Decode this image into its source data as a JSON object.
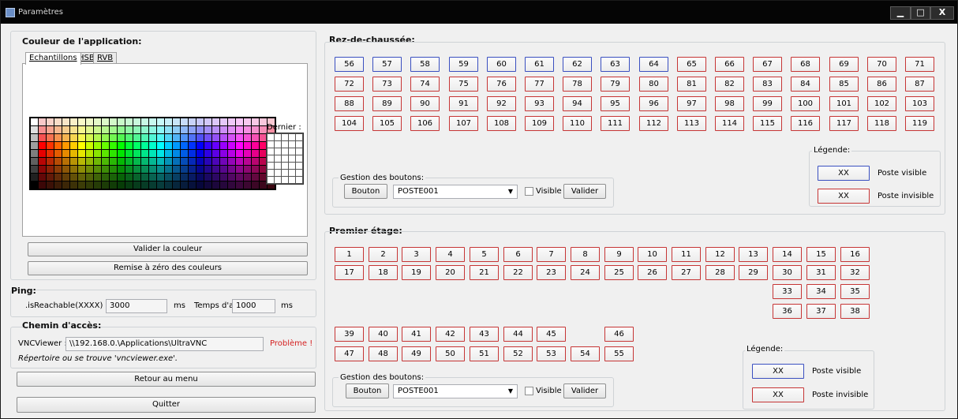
{
  "window": {
    "title": "Paramètres",
    "controls": {
      "minimize": "▁",
      "maximize": "□",
      "close": "X"
    }
  },
  "couleur": {
    "heading": "Couleur de l'application:",
    "tabs": [
      "Echantillons",
      "HSB",
      "RVB"
    ],
    "dernier_label": "Dernier :",
    "valider_label": "Valider la couleur",
    "reset_label": "Remise à zéro des couleurs"
  },
  "ping": {
    "heading": "Ping:",
    "reachable_label": ".isReachable(XXXX) :",
    "reachable_value": "3000",
    "ms1": "ms",
    "attente_label": "Temps d'attente :",
    "attente_value": "1000",
    "ms2": "ms"
  },
  "chemin": {
    "heading": "Chemin d'accès:",
    "vnc_label": "VNCViewer :",
    "vnc_value": "\\\\192.168.0.\\Applications\\UltraVNC",
    "status": "Problème !",
    "hint": "Répertoire ou se trouve 'vncviewer.exe'."
  },
  "buttons": {
    "retour": "Retour au menu",
    "quitter": "Quitter"
  },
  "rdc": {
    "heading": "Rez-de-chaussée:",
    "blue_posts": [
      "56",
      "57",
      "58",
      "59",
      "60",
      "61",
      "62",
      "63",
      "64"
    ],
    "red_posts_row1": [
      "65",
      "66",
      "67",
      "68",
      "69",
      "70",
      "71"
    ],
    "row2": [
      "72",
      "73",
      "74",
      "75",
      "76",
      "77",
      "78",
      "79",
      "80",
      "81",
      "82",
      "83",
      "84",
      "85",
      "86",
      "87"
    ],
    "row3": [
      "88",
      "89",
      "90",
      "91",
      "92",
      "93",
      "94",
      "95",
      "96",
      "97",
      "98",
      "99",
      "100",
      "101",
      "102",
      "103"
    ],
    "row4": [
      "104",
      "105",
      "106",
      "107",
      "108",
      "109",
      "110",
      "111",
      "112",
      "113",
      "114",
      "115",
      "116",
      "117",
      "118",
      "119"
    ],
    "gestion": {
      "label": "Gestion des boutons:",
      "bouton": "Bouton",
      "poste": "POSTE001",
      "visible": "Visible",
      "valider": "Valider"
    },
    "legende": {
      "label": "Légende:",
      "xx1": "XX",
      "visible": "Poste visible",
      "xx2": "XX",
      "invisible": "Poste invisible"
    }
  },
  "etage": {
    "heading": "Premier étage:",
    "row1": [
      "1",
      "2",
      "3",
      "4",
      "5",
      "6",
      "7",
      "8",
      "9",
      "10",
      "11",
      "12",
      "13",
      "14",
      "15",
      "16"
    ],
    "row2": [
      "17",
      "18",
      "19",
      "20",
      "21",
      "22",
      "23",
      "24",
      "25",
      "26",
      "27",
      "28",
      "29",
      "30",
      "31",
      "32"
    ],
    "row3": [
      "33",
      "34",
      "35"
    ],
    "row4": [
      "36",
      "37",
      "38"
    ],
    "row5": [
      "39",
      "40",
      "41",
      "42",
      "43",
      "44",
      "45",
      "46"
    ],
    "row6": [
      "47",
      "48",
      "49",
      "50",
      "51",
      "52",
      "53",
      "54",
      "55"
    ],
    "gestion": {
      "label": "Gestion des boutons:",
      "bouton": "Bouton",
      "poste": "POSTE001",
      "visible": "Visible",
      "valider": "Valider"
    },
    "legende": {
      "label": "Légende:",
      "xx1": "XX",
      "visible": "Poste visible",
      "xx2": "XX",
      "invisible": "Poste invisible"
    }
  },
  "colors": {
    "visible_border": "#3a4fc0",
    "invisible_border": "#c63535",
    "status_error": "#d42020"
  }
}
